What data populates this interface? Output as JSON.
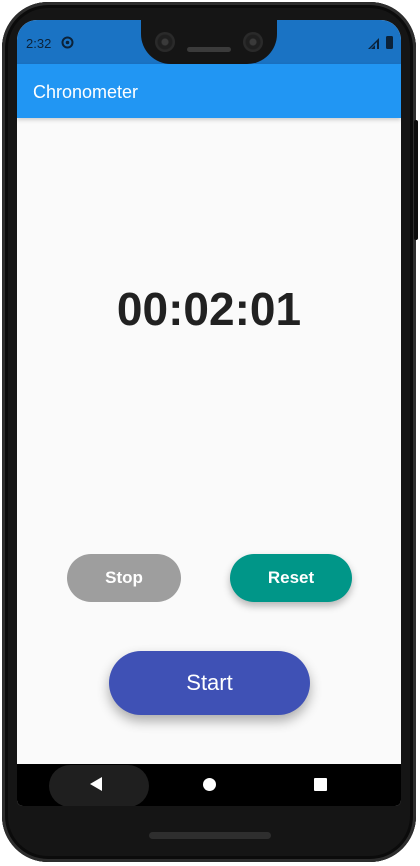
{
  "status_bar": {
    "time": "2:32",
    "sync_icon": "sync-circle-icon",
    "signal_icon": "signal-icon",
    "battery_icon": "battery-icon",
    "color": "#1a73c4"
  },
  "app_bar": {
    "title": "Chronometer",
    "color": "#2196f3"
  },
  "timer": {
    "display": "00:02:01"
  },
  "buttons": {
    "stop": {
      "label": "Stop",
      "color": "#9e9e9e"
    },
    "reset": {
      "label": "Reset",
      "color": "#009688"
    },
    "start": {
      "label": "Start",
      "color": "#3f51b5"
    }
  },
  "navigation_bar": {
    "back_icon": "back-triangle-icon",
    "home_icon": "home-circle-icon",
    "recents_icon": "recents-square-icon"
  }
}
